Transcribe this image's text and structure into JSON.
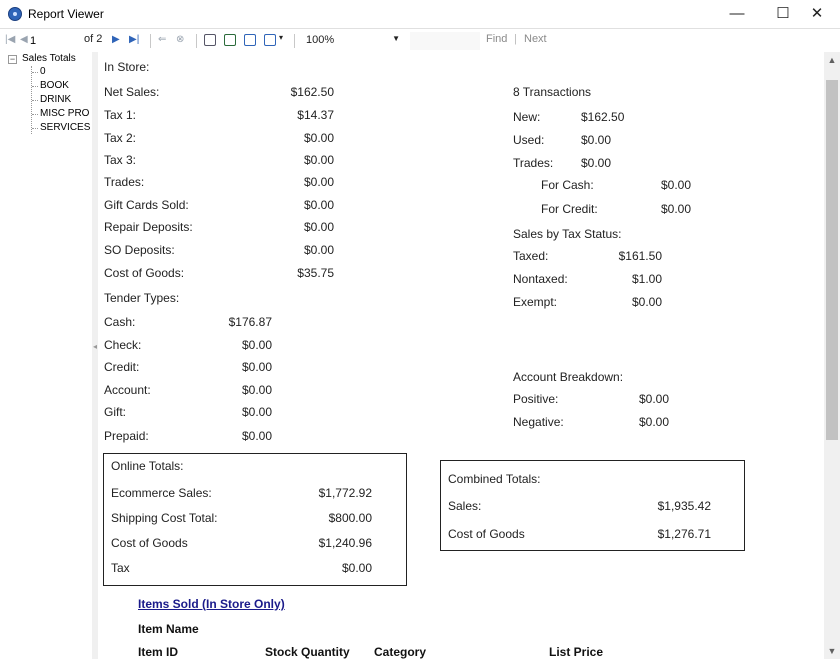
{
  "window": {
    "title": "Report Viewer",
    "minimize": "—",
    "maximize": "☐",
    "close": "✕"
  },
  "toolbar": {
    "page_value": "1",
    "page_of": "of 2",
    "zoom": "100%",
    "find_label": "Find",
    "find_sep": "|",
    "next_label": "Next"
  },
  "tree": {
    "root": "Sales Totals",
    "children": [
      "0",
      "BOOK",
      "DRINK",
      "MISC PRO",
      "SERVICES"
    ]
  },
  "report": {
    "instore_heading": "In Store:",
    "instore": [
      {
        "label": "Net Sales:",
        "value": "$162.50"
      },
      {
        "label": "Tax 1:",
        "value": "$14.37"
      },
      {
        "label": "Tax 2:",
        "value": "$0.00"
      },
      {
        "label": "Tax 3:",
        "value": "$0.00"
      },
      {
        "label": "Trades:",
        "value": "$0.00"
      },
      {
        "label": "Gift Cards Sold:",
        "value": "$0.00"
      },
      {
        "label": "Repair Deposits:",
        "value": "$0.00"
      },
      {
        "label": "SO Deposits:",
        "value": "$0.00"
      },
      {
        "label": "Cost of Goods:",
        "value": "$35.75"
      }
    ],
    "tender_heading": "Tender Types:",
    "tender": [
      {
        "label": "Cash:",
        "value": "$176.87"
      },
      {
        "label": "Check:",
        "value": "$0.00"
      },
      {
        "label": "Credit:",
        "value": "$0.00"
      },
      {
        "label": "Account:",
        "value": "$0.00"
      },
      {
        "label": "Gift:",
        "value": "$0.00"
      },
      {
        "label": "Prepaid:",
        "value": "$0.00"
      }
    ],
    "transactions_heading": "8 Transactions",
    "transactions": [
      {
        "label": "New:",
        "value": "$162.50"
      },
      {
        "label": "Used:",
        "value": "$0.00"
      },
      {
        "label": "Trades:",
        "value": "$0.00"
      }
    ],
    "trades_detail": [
      {
        "label": "For Cash:",
        "value": "$0.00"
      },
      {
        "label": "For Credit:",
        "value": "$0.00"
      }
    ],
    "tax_status_heading": "Sales by Tax Status:",
    "tax_status": [
      {
        "label": "Taxed:",
        "value": "$161.50"
      },
      {
        "label": "Nontaxed:",
        "value": "$1.00"
      },
      {
        "label": "Exempt:",
        "value": "$0.00"
      }
    ],
    "account_heading": "Account Breakdown:",
    "account": [
      {
        "label": "Positive:",
        "value": "$0.00"
      },
      {
        "label": "Negative:",
        "value": "$0.00"
      }
    ],
    "online_heading": "Online Totals:",
    "online": [
      {
        "label": "Ecommerce Sales:",
        "value": "$1,772.92"
      },
      {
        "label": "Shipping Cost Total:",
        "value": "$800.00"
      },
      {
        "label": "Cost of Goods",
        "value": "$1,240.96"
      },
      {
        "label": "Tax",
        "value": "$0.00"
      }
    ],
    "combined_heading": "Combined Totals:",
    "combined": [
      {
        "label": "Sales:",
        "value": "$1,935.42"
      },
      {
        "label": "Cost of Goods",
        "value": "$1,276.71"
      }
    ],
    "items_link": "Items Sold (In Store Only)",
    "item_name_header": "Item Name",
    "columns": [
      "Item ID",
      "Stock Quantity",
      "Category",
      "List Price"
    ]
  }
}
